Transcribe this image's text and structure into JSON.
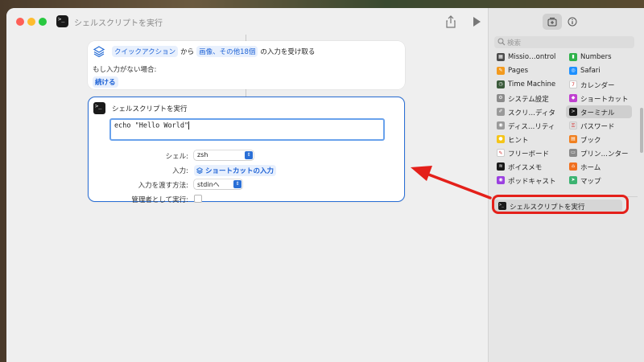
{
  "window": {
    "title": "シェルスクリプトを実行",
    "app_icon_glyph": ">_"
  },
  "receive_action": {
    "source": "クイックアクション",
    "from": "から",
    "types": "画像、その他18個",
    "suffix": "の入力を受け取る",
    "no_input_label": "もし入力がない場合:",
    "no_input_action": "続ける"
  },
  "shell_action": {
    "title": "シェルスクリプトを実行",
    "code": "echo \"Hello World\"",
    "shell_label": "シェル:",
    "shell_value": "zsh",
    "input_label": "入力:",
    "input_value": "ショートカットの入力",
    "pass_label": "入力を渡す方法:",
    "pass_value": "stdinへ",
    "admin_label": "管理者として実行:",
    "admin_checked": false
  },
  "sidebar": {
    "search_placeholder": "検索",
    "items": [
      {
        "label": "Missio…ontrol",
        "color": "#4a4a4a",
        "glyph": "▦"
      },
      {
        "label": "Numbers",
        "color": "#2fb24a",
        "glyph": "▮"
      },
      {
        "label": "Pages",
        "color": "#f39a1e",
        "glyph": "✎"
      },
      {
        "label": "Safari",
        "color": "#1e90ff",
        "glyph": "◎"
      },
      {
        "label": "Time Machine",
        "color": "#3a5a3a",
        "glyph": "◷"
      },
      {
        "label": "カレンダー",
        "color": "#ffffff",
        "glyph": "7"
      },
      {
        "label": "システム設定",
        "color": "#8a8a8a",
        "glyph": "⚙"
      },
      {
        "label": "ショートカット",
        "color": "#c040d0",
        "glyph": "◆"
      },
      {
        "label": "スクリ…ディタ",
        "color": "#9a9a9a",
        "glyph": "✐"
      },
      {
        "label": "ターミナル",
        "color": "#1a1a1a",
        "glyph": ">"
      },
      {
        "label": "ディス…リティ",
        "color": "#9a9a9a",
        "glyph": "◉"
      },
      {
        "label": "パスワード",
        "color": "#e0e0e0",
        "glyph": "⚿"
      },
      {
        "label": "ヒント",
        "color": "#f5c518",
        "glyph": "●"
      },
      {
        "label": "ブック",
        "color": "#f08020",
        "glyph": "▤"
      },
      {
        "label": "フリーボード",
        "color": "#ffffff",
        "glyph": "✎"
      },
      {
        "label": "プリン…ンター",
        "color": "#8a8a8a",
        "glyph": "▭"
      },
      {
        "label": "ボイスメモ",
        "color": "#1a1a1a",
        "glyph": "≋"
      },
      {
        "label": "ホーム",
        "color": "#f07020",
        "glyph": "⌂"
      },
      {
        "label": "ポッドキャスト",
        "color": "#9b40e0",
        "glyph": "◉"
      },
      {
        "label": "マップ",
        "color": "#3cb371",
        "glyph": "➤"
      }
    ],
    "selected_index": 9,
    "result_item": "シェルスクリプトを実行"
  },
  "colors": {
    "accent": "#2a6fd6",
    "annotation": "#e4201a"
  }
}
